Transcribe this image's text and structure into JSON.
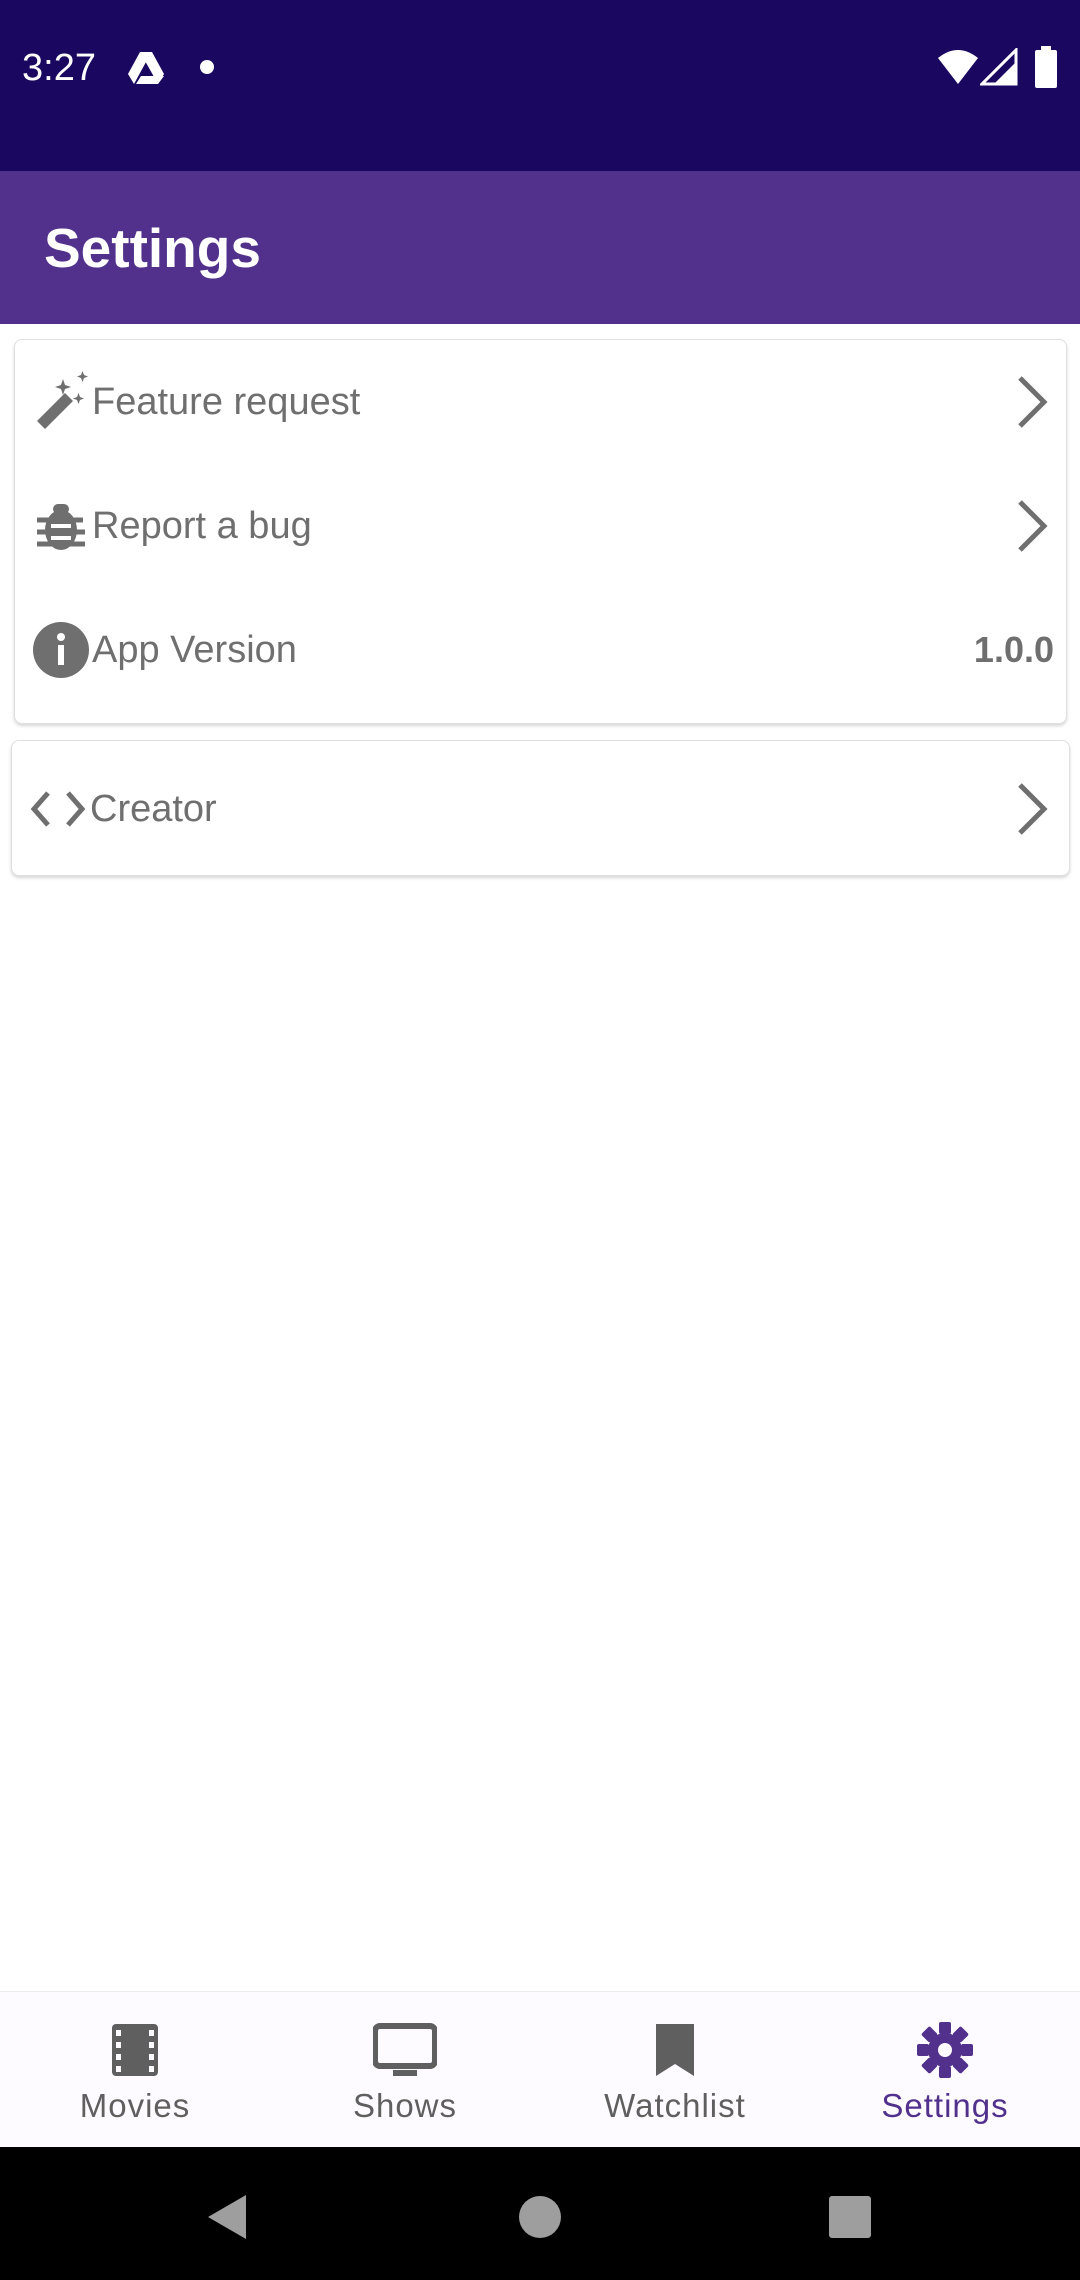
{
  "status_bar": {
    "time": "3:27",
    "icons": [
      "google-drive-icon",
      "notification-dot-icon",
      "wifi-icon",
      "cell-signal-icon",
      "battery-icon"
    ]
  },
  "app_bar": {
    "title": "Settings"
  },
  "settings_items": [
    {
      "label": "Feature request",
      "icon": "magic-wand-icon",
      "chevron": true
    },
    {
      "label": "Report a bug",
      "icon": "bug-icon",
      "chevron": true
    },
    {
      "label": "App Version",
      "icon": "info-icon",
      "value": "1.0.0"
    }
  ],
  "creator_item": {
    "label": "Creator",
    "icon": "code-icon",
    "chevron": true
  },
  "bottom_nav": {
    "items": [
      {
        "label": "Movies",
        "icon": "film-icon"
      },
      {
        "label": "Shows",
        "icon": "tv-icon"
      },
      {
        "label": "Watchlist",
        "icon": "bookmark-icon"
      },
      {
        "label": "Settings",
        "icon": "gear-icon",
        "active": true
      }
    ]
  },
  "colors": {
    "status_bar": "#1a0760",
    "app_bar": "#51318c",
    "accent": "#51318c",
    "text_secondary": "#6f6f6f"
  }
}
